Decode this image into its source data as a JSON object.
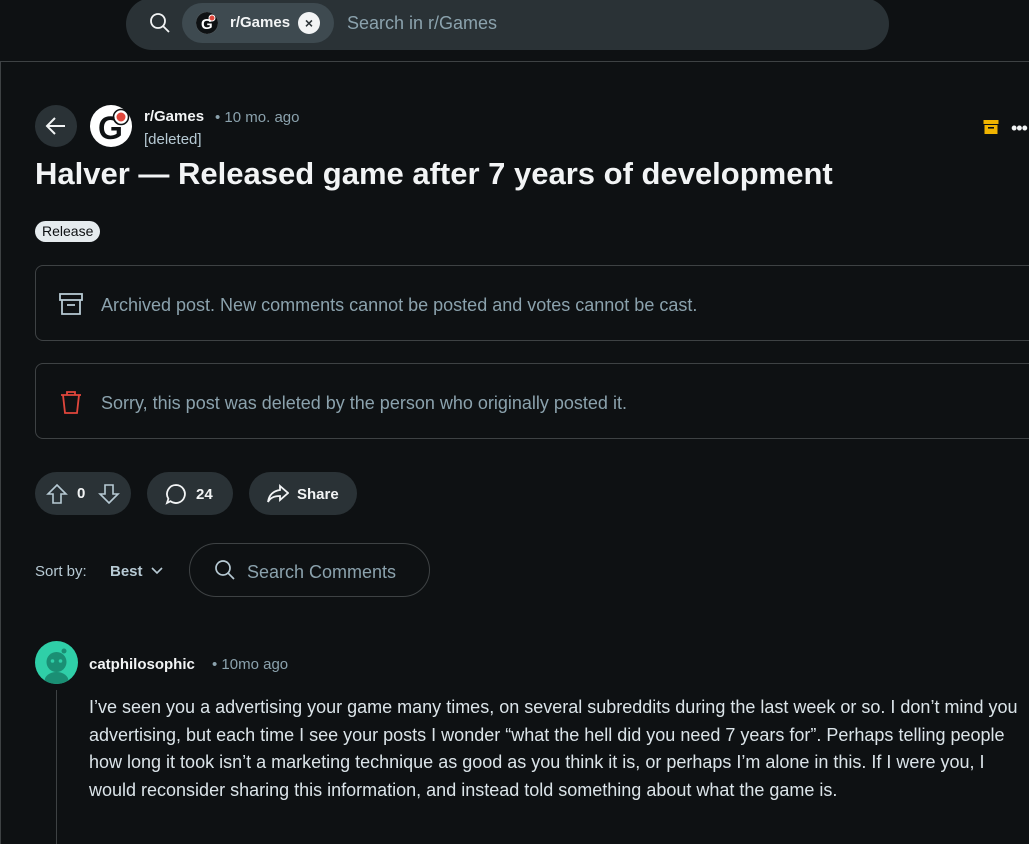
{
  "search": {
    "chip_label": "r/Games",
    "chip_close": "×",
    "placeholder": "Search in r/Games"
  },
  "post": {
    "subreddit": "r/Games",
    "time": "• 10 mo. ago",
    "author": "[deleted]",
    "more": "•••",
    "title": "Halver — Released game after 7 years of development",
    "flair": "Release",
    "archived_notice": "Archived post. New comments cannot be posted and votes cannot be cast.",
    "deleted_notice": "Sorry, this post was deleted by the person who originally posted it.",
    "votes": "0",
    "comments": "24",
    "share_label": "Share"
  },
  "comments_bar": {
    "sort_label": "Sort by:",
    "sort_value": "Best",
    "search_placeholder": "Search Comments"
  },
  "comment": {
    "author": "catphilosophic",
    "time": "• 10mo ago",
    "body": "I’ve seen you a advertising your game many times, on several subreddits during the last week or so. I don’t mind you advertising, but each time I see your posts I wonder “what the hell did you need 7 years for”. Perhaps telling people how long it took isn’t a marketing technique as good as you think it is, or perhaps I’m alone in this. If I were you, I would reconsider sharing this information, and instead told something about what the game is."
  },
  "colors": {
    "background": "#0e1113",
    "pill": "#2a3236",
    "muted_text": "#8ba2ad",
    "delete_red": "#e0463c",
    "archive_gold": "#f0b400",
    "avatar": "#2fcfa8"
  }
}
